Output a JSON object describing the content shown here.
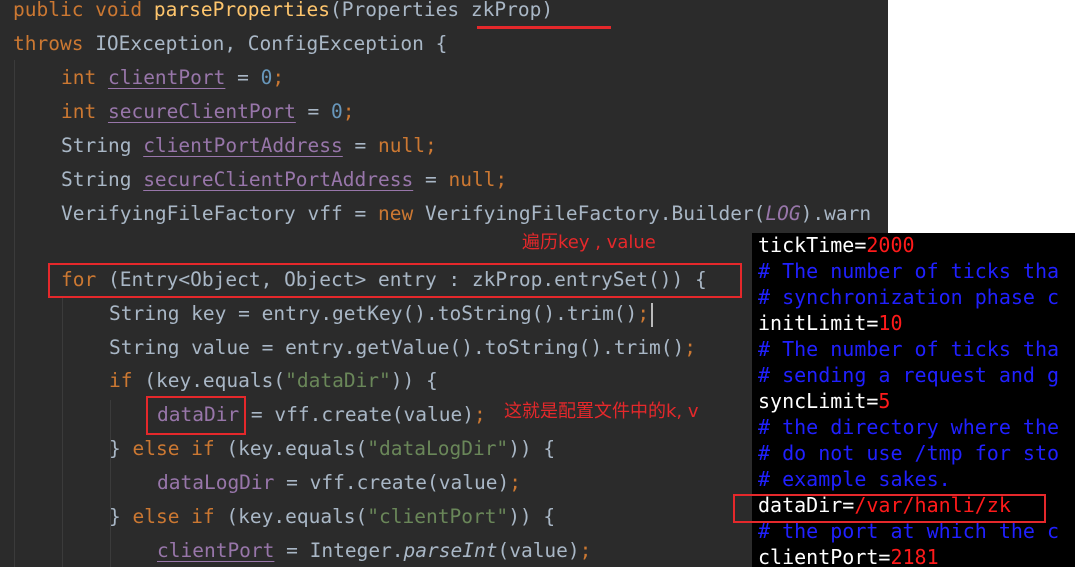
{
  "editor": {
    "lines": [
      {
        "parts": [
          [
            "kw",
            "public void "
          ],
          [
            "fn",
            "parseProperties"
          ],
          [
            "pln",
            "(Properties "
          ],
          [
            "pln",
            "zkProp"
          ],
          [
            "pln",
            ")"
          ]
        ]
      },
      {
        "parts": [
          [
            "kw",
            "throws "
          ],
          [
            "pln",
            "IOException, ConfigException {"
          ]
        ]
      },
      {
        "parts": [
          [
            "kw",
            "int "
          ],
          [
            "field ul",
            "clientPort"
          ],
          [
            "pln",
            " = "
          ],
          [
            "num",
            "0"
          ],
          [
            "semi",
            ";"
          ]
        ]
      },
      {
        "parts": [
          [
            "kw",
            "int "
          ],
          [
            "field ul",
            "secureClientPort"
          ],
          [
            "pln",
            " = "
          ],
          [
            "num",
            "0"
          ],
          [
            "semi",
            ";"
          ]
        ]
      },
      {
        "parts": [
          [
            "pln",
            "String "
          ],
          [
            "field ul",
            "clientPortAddress"
          ],
          [
            "pln",
            " = "
          ],
          [
            "kw",
            "null"
          ],
          [
            "semi",
            ";"
          ]
        ]
      },
      {
        "parts": [
          [
            "pln",
            "String "
          ],
          [
            "field ul",
            "secureClientPortAddress"
          ],
          [
            "pln",
            " = "
          ],
          [
            "kw",
            "null"
          ],
          [
            "semi",
            ";"
          ]
        ]
      },
      {
        "parts": [
          [
            "pln",
            "VerifyingFileFactory vff = "
          ],
          [
            "kw",
            "new "
          ],
          [
            "pln",
            "VerifyingFileFactory.Builder("
          ],
          [
            "field it",
            "LOG"
          ],
          [
            "pln",
            ").warn"
          ]
        ]
      },
      {
        "parts": []
      },
      {
        "parts": [
          [
            "kw",
            "for "
          ],
          [
            "pln",
            "(Entry<Object, Object> entry : zkProp.entrySet()) {"
          ]
        ]
      },
      {
        "parts": [
          [
            "pln",
            "String key = entry.getKey().toString().trim()"
          ],
          [
            "semi",
            ";"
          ]
        ]
      },
      {
        "parts": [
          [
            "pln",
            "String value = entry.getValue().toString().trim()"
          ],
          [
            "semi",
            ";"
          ]
        ]
      },
      {
        "parts": [
          [
            "kw",
            "if "
          ],
          [
            "pln",
            "(key.equals("
          ],
          [
            "str",
            "\"dataDir\""
          ],
          [
            "pln",
            ")) {"
          ]
        ]
      },
      {
        "parts": [
          [
            "field",
            "dataDir"
          ],
          [
            "pln",
            " = vff.create(value)"
          ],
          [
            "semi",
            ";"
          ]
        ]
      },
      {
        "parts": [
          [
            "pln",
            "} "
          ],
          [
            "kw",
            "else if "
          ],
          [
            "pln",
            "(key.equals("
          ],
          [
            "str",
            "\"dataLogDir\""
          ],
          [
            "pln",
            ")) {"
          ]
        ]
      },
      {
        "parts": [
          [
            "field",
            "dataLogDir"
          ],
          [
            "pln",
            " = vff.create(value)"
          ],
          [
            "semi",
            ";"
          ]
        ]
      },
      {
        "parts": [
          [
            "pln",
            "} "
          ],
          [
            "kw",
            "else if "
          ],
          [
            "pln",
            "(key.equals("
          ],
          [
            "str",
            "\"clientPort\""
          ],
          [
            "pln",
            ")) {"
          ]
        ]
      },
      {
        "parts": [
          [
            "field ul",
            "clientPort"
          ],
          [
            "pln",
            " = Integer."
          ],
          [
            "pln it",
            "parseInt"
          ],
          [
            "pln",
            "(value)"
          ],
          [
            "semi",
            ";"
          ]
        ]
      }
    ]
  },
  "config": {
    "lines": [
      {
        "parts": [
          [
            "ck",
            "tickTime="
          ],
          [
            "cv",
            "2000"
          ]
        ]
      },
      {
        "parts": [
          [
            "cc",
            "# The number of ticks tha"
          ]
        ]
      },
      {
        "parts": [
          [
            "cc",
            "# synchronization phase c"
          ]
        ]
      },
      {
        "parts": [
          [
            "ck",
            "initLimit="
          ],
          [
            "cv",
            "10"
          ]
        ]
      },
      {
        "parts": [
          [
            "cc",
            "# The number of ticks tha"
          ]
        ]
      },
      {
        "parts": [
          [
            "cc",
            "# sending a request and g"
          ]
        ]
      },
      {
        "parts": [
          [
            "ck",
            "syncLimit="
          ],
          [
            "cv",
            "5"
          ]
        ]
      },
      {
        "parts": [
          [
            "cc",
            "# the directory where the"
          ]
        ]
      },
      {
        "parts": [
          [
            "cc",
            "# do not use /tmp for sto"
          ]
        ]
      },
      {
        "parts": [
          [
            "cc",
            "# example sakes."
          ]
        ]
      },
      {
        "parts": [
          [
            "ck",
            "dataDir="
          ],
          [
            "cv",
            "/var/hanli/zk"
          ]
        ]
      },
      {
        "parts": [
          [
            "cc",
            "# the port at which the c"
          ]
        ]
      },
      {
        "parts": [
          [
            "ck",
            "clientPort="
          ],
          [
            "cv",
            "2181"
          ]
        ]
      }
    ]
  },
  "annotations": {
    "iterate_note": "遍历key , value",
    "config_note": "这就是配置文件中的k, v"
  },
  "colors": {
    "annotation": "#e5282b",
    "editor_bg": "#2b2b2b",
    "keyword": "#cc7832",
    "method": "#ffc66d",
    "number": "#6897bb",
    "string": "#6a8759",
    "field": "#9876aa",
    "config_key": "#ffffff",
    "config_value": "#ff1a1a",
    "config_comment": "#2020ff"
  }
}
